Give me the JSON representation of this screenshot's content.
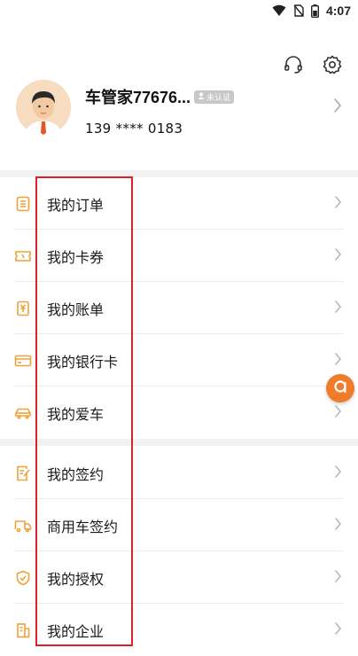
{
  "status_bar": {
    "time": "4:07"
  },
  "profile": {
    "name": "车管家77676...",
    "badge": "未认证",
    "phone": "139 **** 0183"
  },
  "menu_group_1": [
    {
      "label": "我的订单",
      "icon": "order-list-icon"
    },
    {
      "label": "我的卡券",
      "icon": "coupon-icon"
    },
    {
      "label": "我的账单",
      "icon": "bill-icon"
    },
    {
      "label": "我的银行卡",
      "icon": "bank-card-icon"
    },
    {
      "label": "我的爱车",
      "icon": "car-icon"
    }
  ],
  "menu_group_2": [
    {
      "label": "我的签约",
      "icon": "contract-icon"
    },
    {
      "label": "商用车签约",
      "icon": "truck-icon"
    },
    {
      "label": "我的授权",
      "icon": "shield-icon"
    },
    {
      "label": "我的企业",
      "icon": "building-icon"
    }
  ],
  "colors": {
    "accent": "#f0a23a",
    "highlight": "#d8232a",
    "float_button": "#f07b2a"
  }
}
